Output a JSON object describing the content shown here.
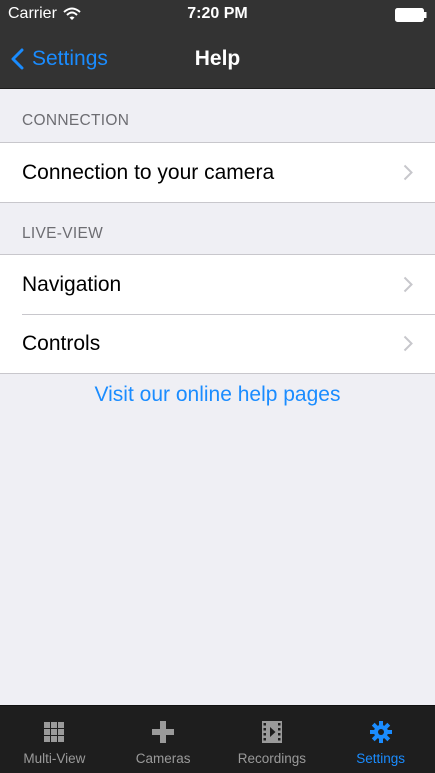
{
  "status_bar": {
    "carrier": "Carrier",
    "time": "7:20 PM"
  },
  "nav": {
    "back_label": "Settings",
    "title": "Help"
  },
  "sections": [
    {
      "header": "CONNECTION",
      "rows": [
        {
          "label": "Connection to your camera"
        }
      ]
    },
    {
      "header": "LIVE-VIEW",
      "rows": [
        {
          "label": "Navigation"
        },
        {
          "label": "Controls"
        }
      ]
    }
  ],
  "help_link": "Visit our online help pages",
  "tabs": [
    {
      "label": "Multi-View",
      "icon": "grid-icon"
    },
    {
      "label": "Cameras",
      "icon": "plus-icon"
    },
    {
      "label": "Recordings",
      "icon": "film-icon"
    },
    {
      "label": "Settings",
      "icon": "gear-icon",
      "active": true
    }
  ],
  "colors": {
    "accent": "#1a8cff",
    "bar_background": "#333333",
    "tab_bar_background": "#1e1e1e",
    "page_background": "#efeff4"
  }
}
